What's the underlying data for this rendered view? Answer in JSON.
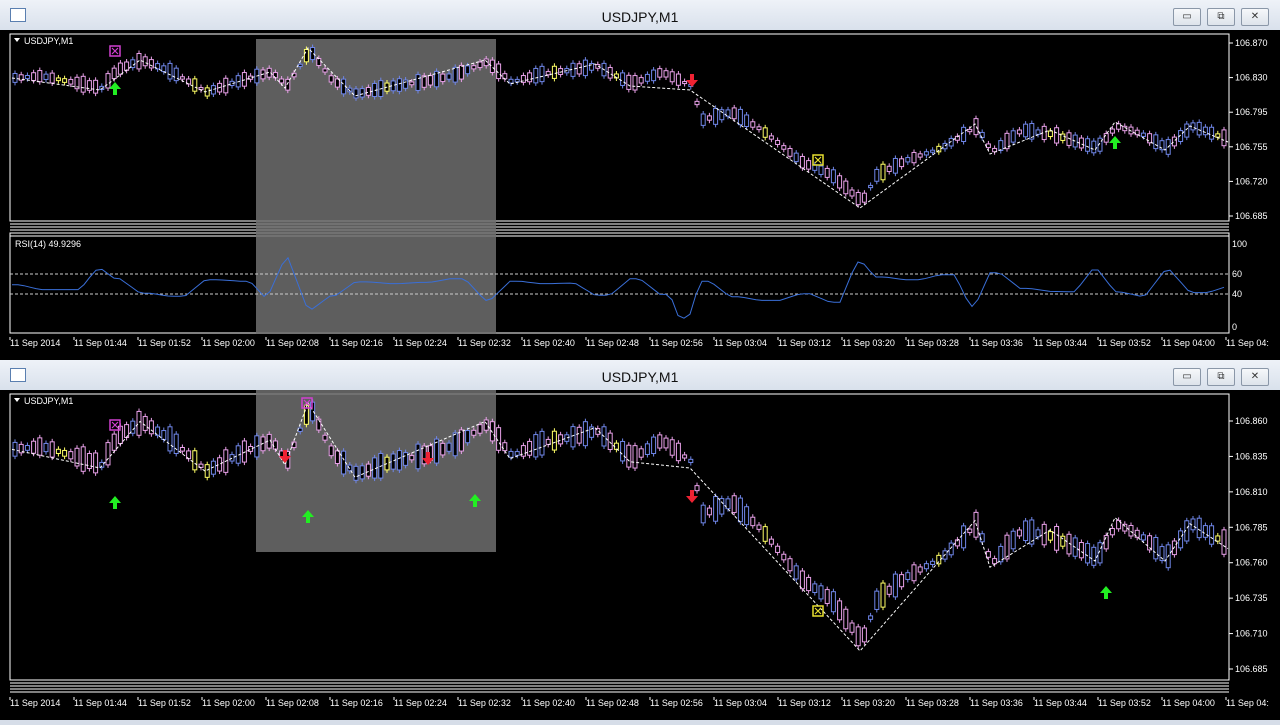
{
  "windows": [
    {
      "title": "USDJPY,M1",
      "symbol_label": "USDJPY,M1",
      "price_labels": [
        "106.870",
        "106.830",
        "106.795",
        "106.755",
        "106.720",
        "106.685"
      ],
      "rsi": {
        "label": "RSI(14) 49.9296",
        "levels": [
          "100",
          "60",
          "40",
          "0"
        ]
      },
      "time_labels": [
        "11 Sep 2014",
        "11 Sep 01:44",
        "11 Sep 01:52",
        "11 Sep 02:00",
        "11 Sep 02:08",
        "11 Sep 02:16",
        "11 Sep 02:24",
        "11 Sep 02:32",
        "11 Sep 02:40",
        "11 Sep 02:48",
        "11 Sep 02:56",
        "11 Sep 03:04",
        "11 Sep 03:12",
        "11 Sep 03:20",
        "11 Sep 03:28",
        "11 Sep 03:36",
        "11 Sep 03:44",
        "11 Sep 03:52",
        "11 Sep 04:00",
        "11 Sep 04:"
      ]
    },
    {
      "title": "USDJPY,M1",
      "symbol_label": "USDJPY,M1",
      "price_labels": [
        "106.860",
        "106.835",
        "106.810",
        "106.785",
        "106.760",
        "106.735",
        "106.710",
        "106.685"
      ],
      "time_labels": [
        "11 Sep 2014",
        "11 Sep 01:44",
        "11 Sep 01:52",
        "11 Sep 02:00",
        "11 Sep 02:08",
        "11 Sep 02:16",
        "11 Sep 02:24",
        "11 Sep 02:32",
        "11 Sep 02:40",
        "11 Sep 02:48",
        "11 Sep 02:56",
        "11 Sep 03:04",
        "11 Sep 03:12",
        "11 Sep 03:20",
        "11 Sep 03:28",
        "11 Sep 03:36",
        "11 Sep 03:44",
        "11 Sep 03:52",
        "11 Sep 04:00",
        "11 Sep 04:"
      ]
    }
  ],
  "window_buttons": {
    "minimize": "▭",
    "maximize": "⧉",
    "close": "✕"
  },
  "colors": {
    "bull": "#6f86e8",
    "bear": "#e8a0e8",
    "doji": "#ffff66",
    "zigzag": "#ffffff",
    "rsi_line": "#3a6fd8",
    "highlight": "#6e6e6e",
    "up_arrow": "#22ee22",
    "down_arrow": "#ee2233",
    "box_pink": "#d040d0",
    "box_yellow": "#e8e030"
  },
  "icons": [
    "app-icon",
    "up-arrow-icon",
    "down-arrow-icon",
    "pink-box-icon",
    "yellow-box-icon",
    "dropdown-icon"
  ]
}
